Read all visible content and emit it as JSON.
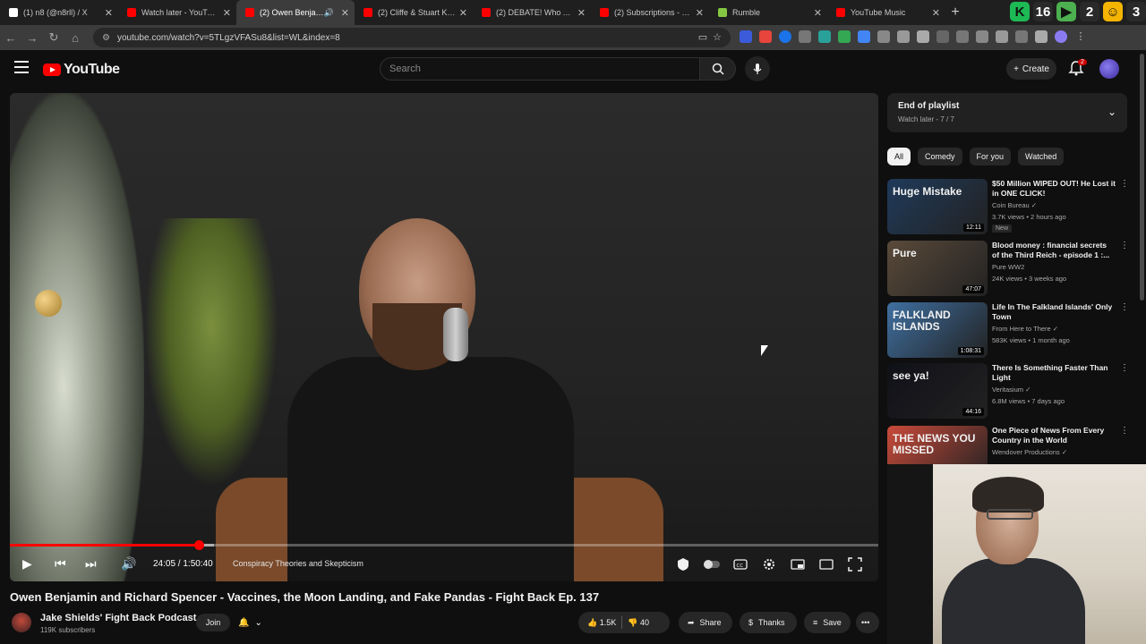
{
  "browser": {
    "tabs": [
      {
        "label": "(1) n8 (@n8rll) / X",
        "favicon_color": "#ffffff",
        "close": "✕"
      },
      {
        "label": "Watch later - YouTube",
        "favicon_color": "#ff0000",
        "close": "✕"
      },
      {
        "label": "(2) Owen Benjamin",
        "favicon_color": "#ff0000",
        "close": "✕",
        "active": true,
        "audio": "🔊"
      },
      {
        "label": "(2) Cliffe & Stuart Knech",
        "favicon_color": "#ff0000",
        "close": "✕"
      },
      {
        "label": "(2) DEBATE! Who Are th",
        "favicon_color": "#ff0000",
        "close": "✕"
      },
      {
        "label": "(2) Subscriptions - YouT",
        "favicon_color": "#ff0000",
        "close": "✕"
      },
      {
        "label": "Rumble",
        "favicon_color": "#85c742",
        "close": "✕"
      },
      {
        "label": "YouTube Music",
        "favicon_color": "#ff0000",
        "close": "✕"
      }
    ],
    "new_tab": "+",
    "corner_badges": [
      {
        "text": "K",
        "color": "#1db954"
      },
      {
        "text": "16",
        "color": "#2a2a2a"
      },
      {
        "text": "▶",
        "color": "#4caf50"
      },
      {
        "text": "2",
        "color": "#2a2a2a"
      },
      {
        "text": "☺",
        "color": "#f4b400"
      },
      {
        "text": "3",
        "color": "#2a2a2a"
      }
    ],
    "url": "youtube.com/watch?v=5TLgzVFASu8&list=WL&index=8"
  },
  "youtube": {
    "logo_text": "YouTube",
    "search_placeholder": "Search",
    "create_label": "Create",
    "notification_count": "2"
  },
  "player": {
    "current_time": "24:05",
    "duration": "1:50:40",
    "time_display": "24:05 / 1:50:40",
    "chapter": "Conspiracy Theories and Skepticism",
    "progress_fraction": 0.2175,
    "buffer_fraction": 0.235
  },
  "video": {
    "title": "Owen Benjamin and Richard Spencer - Vaccines, the Moon Landing, and Fake Pandas - Fight Back Ep. 137",
    "channel": "Jake Shields' Fight Back Podcast",
    "subscribers": "119K subscribers",
    "join_label": "Join",
    "likes": "1.5K",
    "dislikes": "40",
    "share_label": "Share",
    "thanks_label": "Thanks",
    "save_label": "Save",
    "more_label": "•••"
  },
  "playlist": {
    "title": "End of playlist",
    "subtitle": "Watch later - 7 / 7"
  },
  "chips": [
    "All",
    "Comedy",
    "For you",
    "Watched"
  ],
  "recommendations": [
    {
      "title": "$50 Million WIPED OUT! He Lost it in ONE CLICK!",
      "channel": "Coin Bureau ✓",
      "meta": "3.7K views • 2 hours ago",
      "badge": "New",
      "duration": "12:11",
      "thumb_text": "Huge Mistake",
      "thumb_bg": "#1f3a5a"
    },
    {
      "title": "Blood money : financial secrets of the Third Reich - episode 1 :...",
      "channel": "Pure WW2",
      "meta": "24K views • 3 weeks ago",
      "badge": "",
      "duration": "47:07",
      "thumb_text": "Pure",
      "thumb_bg": "#5a4a3a"
    },
    {
      "title": "Life In The Falkland Islands' Only Town",
      "channel": "From Here to There ✓",
      "meta": "583K views • 1 month ago",
      "badge": "",
      "duration": "1:08:31",
      "thumb_text": "FALKLAND ISLANDS",
      "thumb_bg": "#3f6fa0"
    },
    {
      "title": "There Is Something Faster Than Light",
      "channel": "Veritasium ✓",
      "meta": "6.8M views • 7 days ago",
      "badge": "",
      "duration": "44:16",
      "thumb_text": "see ya!",
      "thumb_bg": "#101018"
    },
    {
      "title": "One Piece of News From Every Country in the World",
      "channel": "Wendover Productions ✓",
      "meta": "",
      "badge": "",
      "duration": "",
      "thumb_text": "THE NEWS YOU MISSED",
      "thumb_bg": "#c94a3a"
    }
  ]
}
